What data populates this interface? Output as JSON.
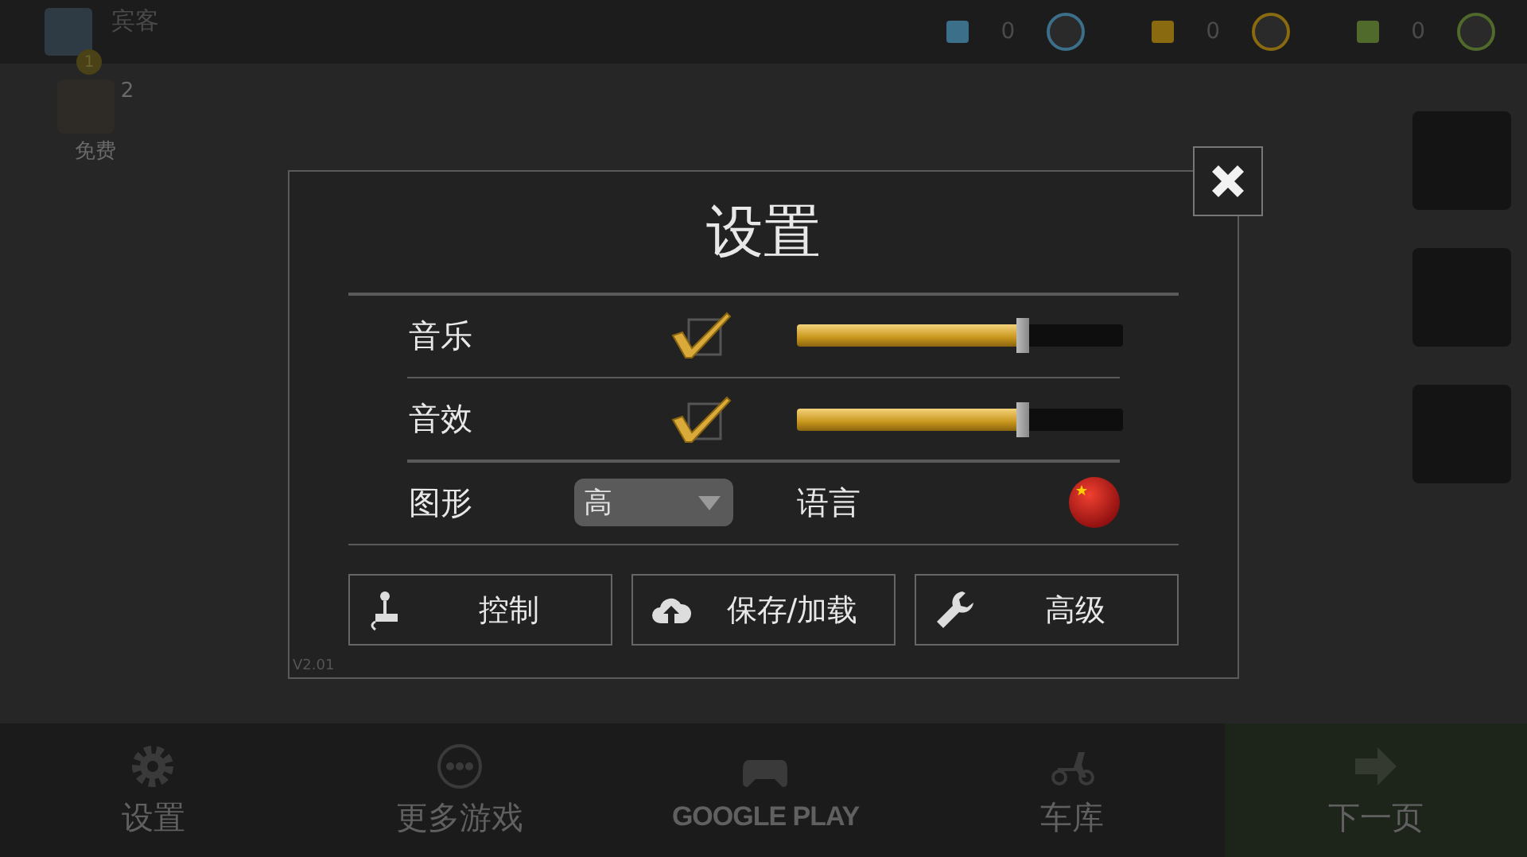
{
  "top_bar": {
    "player_name": "宾客",
    "player_level": "1",
    "currencies": [
      {
        "amount": "0",
        "color": "#3b6f8a"
      },
      {
        "amount": "0",
        "color": "#8a6a10"
      },
      {
        "amount": "0",
        "color": "#4f6a2a"
      }
    ]
  },
  "side_item": {
    "badge": "2",
    "label": "免费"
  },
  "dialog": {
    "title": "设置",
    "audio": [
      {
        "label": "音乐",
        "checked": true,
        "level": 0.69
      },
      {
        "label": "音效",
        "checked": true,
        "level": 0.69
      }
    ],
    "graphics": {
      "label": "图形",
      "value": "高"
    },
    "language": {
      "label": "语言"
    },
    "buttons": [
      {
        "label": "控制",
        "kind": "joystick"
      },
      {
        "label": "保存/加载",
        "kind": "cloud"
      },
      {
        "label": "高级",
        "kind": "wrench"
      }
    ],
    "version": "V2.01"
  },
  "bottom_nav": [
    {
      "label": "设置",
      "kind": "gear",
      "highlighted": false
    },
    {
      "label": "更多游戏",
      "kind": "dots",
      "highlighted": false
    },
    {
      "label": "GOOGLE PLAY",
      "kind": "gamepad",
      "highlighted": false
    },
    {
      "label": "车库",
      "kind": "scooter",
      "highlighted": false
    },
    {
      "label": "下一页",
      "kind": "arrow",
      "highlighted": true
    }
  ]
}
